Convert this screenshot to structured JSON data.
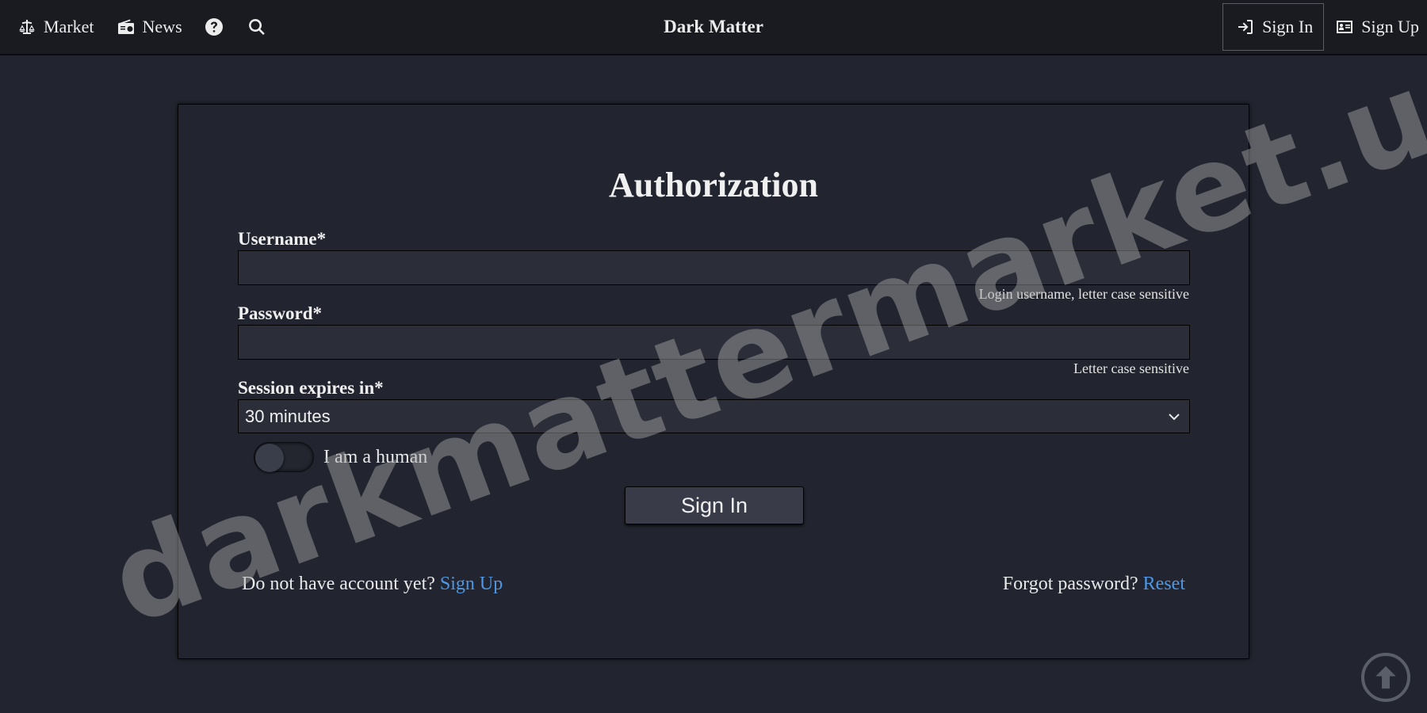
{
  "navbar": {
    "brand": "Dark Matter",
    "market_label": "Market",
    "news_label": "News",
    "signin_label": "Sign In",
    "signup_label": "Sign Up"
  },
  "form": {
    "title": "Authorization",
    "username_label": "Username*",
    "username_value": "",
    "username_hint": "Login username, letter case sensitive",
    "password_label": "Password*",
    "password_value": "",
    "password_hint": "Letter case sensitive",
    "session_label": "Session expires in*",
    "session_value": "30 minutes",
    "human_label": "I am a human",
    "human_checked": false,
    "submit_label": "Sign In",
    "no_account_text": "Do not have account yet?",
    "signup_link": "Sign Up",
    "forgot_text": "Forgot password?",
    "reset_link": "Reset"
  },
  "watermark": "darkmattermarket.us",
  "colors": {
    "background": "#22252f",
    "navbar": "#191b21",
    "link": "#4d97e6"
  }
}
